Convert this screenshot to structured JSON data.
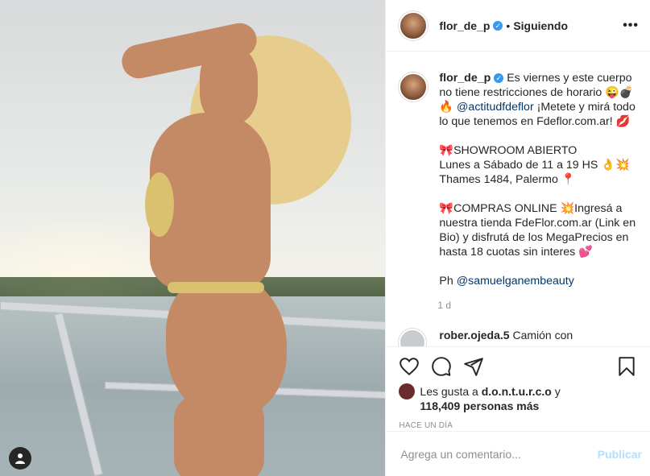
{
  "header": {
    "username": "flor_de_p",
    "separator": "•",
    "follow_status": "Siguiendo",
    "more": "•••"
  },
  "caption": {
    "username": "flor_de_p",
    "lines": [
      "Es viernes y este cuerpo no tiene restricciones de horario 😜💣🔥",
      "¡Metete y mirá todo lo que tenemos en Fdeflor.com.ar! 💋",
      "🎀SHOWROOM ABIERTO",
      "Lunes a Sábado de 11 a 19 HS 👌💥",
      "Thames 1484, Palermo 📍",
      "🎀COMPRAS ONLINE 💥Ingresá a nuestra tienda FdeFlor.com.ar (Link en Bio) y disfrutá de los MegaPrecios en hasta 18 cuotas sin interes 💕",
      "Ph "
    ],
    "mention1": "@actitudfdeflor",
    "mention2": "@samuelganembeauty",
    "time": "1 d"
  },
  "next_comment": {
    "username": "rober.ojeda.5",
    "text": "Camión con"
  },
  "likes": {
    "prefix": "Les gusta a",
    "user": "d.o.n.t.u.r.c.o",
    "conj": "y",
    "count": "118,409 personas más"
  },
  "posted": "HACE UN DÍA",
  "comment_box": {
    "placeholder": "Agrega un comentario...",
    "publish": "Publicar"
  },
  "icons": {
    "like": "heart-icon",
    "comment": "comment-icon",
    "share": "share-icon",
    "save": "bookmark-icon",
    "tag": "user-tag-icon"
  },
  "colors": {
    "verified": "#3897f0",
    "link": "#00376b",
    "publish": "#b2dffc",
    "muted": "#8e8e8e"
  }
}
